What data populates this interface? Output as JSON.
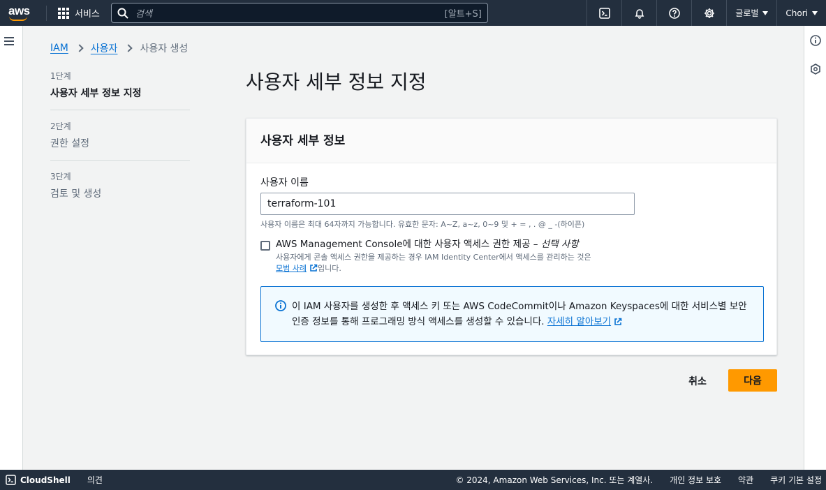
{
  "topnav": {
    "logo_text": "aws",
    "services_label": "서비스",
    "search_placeholder": "검색",
    "search_shortcut": "[알트+S]",
    "region_label": "글로벌",
    "user_label": "Chori"
  },
  "breadcrumb": {
    "items": [
      "IAM",
      "사용자",
      "사용자 생성"
    ]
  },
  "steps": [
    {
      "number": "1단계",
      "label": "사용자 세부 정보 지정"
    },
    {
      "number": "2단계",
      "label": "권한 설정"
    },
    {
      "number": "3단계",
      "label": "검토 및 생성"
    }
  ],
  "page_title": "사용자 세부 정보 지정",
  "panel": {
    "title": "사용자 세부 정보",
    "username_label": "사용자 이름",
    "username_value": "terraform-101",
    "username_hint": "사용자 이름은 최대 64자까지 가능합니다. 유효한 문자: A~Z, a~z, 0~9 및 + = , . @ _ -(하이픈)",
    "console_access_label": "AWS Management Console에 대한 사용자 액세스 권한 제공 –",
    "console_access_optional": "선택 사항",
    "console_access_checked": false,
    "console_access_desc": "사용자에게 콘솔 액세스 권한을 제공하는 경우 IAM Identity Center에서 액세스를 관리하는 것은",
    "console_access_link": "모범 사례",
    "console_access_suffix": "입니다.",
    "info_text": "이 IAM 사용자를 생성한 후 액세스 키 또는 AWS CodeCommit이나 Amazon Keyspaces에 대한 서비스별 보안 인증 정보를 통해 프로그래밍 방식 액세스를 생성할 수 있습니다.",
    "info_link": "자세히 알아보기"
  },
  "actions": {
    "cancel_label": "취소",
    "next_label": "다음"
  },
  "footer": {
    "cloudshell_label": "CloudShell",
    "feedback_label": "의견",
    "copyright": "© 2024, Amazon Web Services, Inc. 또는 계열사.",
    "privacy_label": "개인 정보 보호",
    "terms_label": "약관",
    "cookie_label": "쿠키 기본 설정"
  },
  "colors": {
    "nav_bg": "#232f3e",
    "link": "#0972d3",
    "primary_button": "#ff9900",
    "info_bg": "#f1faff"
  }
}
